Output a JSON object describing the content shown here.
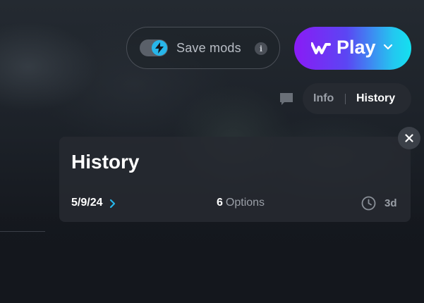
{
  "header": {
    "save_mods": {
      "label": "Save mods",
      "info_glyph": "i",
      "toggle_on": true,
      "toggle_icon": "lightning-bolt-icon",
      "toggle_color": "#27b6ea"
    },
    "play_button": {
      "label": "Play",
      "logo_icon": "w-logo-icon",
      "dropdown_icon": "chevron-down-icon",
      "gradient": [
        "#8a1bf5",
        "#23c8f0"
      ]
    }
  },
  "tabs": {
    "chat_icon": "chat-bubble-icon",
    "items": [
      {
        "label": "Info",
        "active": false
      },
      {
        "label": "History",
        "active": true
      }
    ]
  },
  "history_panel": {
    "title": "History",
    "date": "5/9/24",
    "date_chevron_icon": "chevron-right-icon",
    "date_chevron_color": "#27b6ea",
    "options_count": "6",
    "options_label": "Options",
    "clock_icon": "clock-icon",
    "age": "3d",
    "close_icon": "close-icon"
  }
}
